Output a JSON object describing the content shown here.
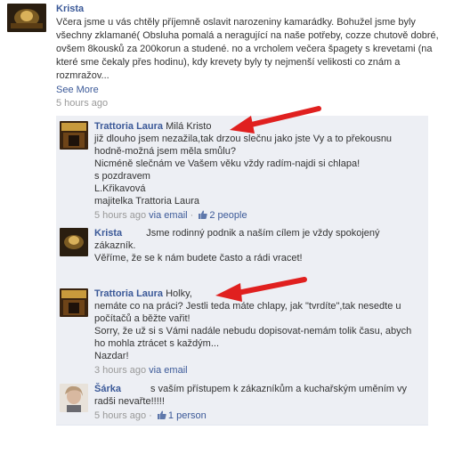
{
  "post": {
    "author": "Krista",
    "text": "Včera jsme u vás chtěly příjemně oslavit narozeniny kamarádky. Bohužel jsme byly všechny zklamané( Obsluha pomalá a neragující na naše potřeby, cozze chutově dobré, ovšem 8kousků za 200korun a studené. no a vrcholem večera špagety s krevetami (na které sme čekaly přes hodinu), kdy krevety byly ty nejmenší velikosti co znám a rozmražov...",
    "see_more": "See More",
    "time": "5 hours ago"
  },
  "comments": [
    {
      "author": "Trattoria Laura",
      "lines": [
        "Milá Kristo",
        "již dlouho jsem nezažila,tak drzou slečnu jako jste Vy a to překousnu hodně-možná jsem měla smůlu?",
        "Nicméně slečnám ve Vašem věku vždy radím-najdi si chlapa!",
        "s pozdravem",
        "L.Křikavová",
        "majitelka Trattoria Laura"
      ],
      "time": "5 hours ago",
      "via": "via email",
      "sep": "·",
      "likes": "2 people"
    },
    {
      "author": "Krista",
      "lines": [
        "Jsme rodinný podnik a naším cílem je vždy spokojený zákazník.",
        "Věříme, že se k nám budete často a rádi vracet!"
      ],
      "time": "",
      "via": "",
      "likes": ""
    },
    {
      "author": "Trattoria Laura",
      "lines": [
        "Holky,",
        "nemáte co na práci? Jestli teda máte chlapy, jak \"tvrdíte\",tak nesedte u počítačů a běžte vařit!",
        "Sorry, že už si s Vámi nadále nebudu dopisovat-nemám tolik času, abych ho mohla ztrácet s každým...",
        "Nazdar!"
      ],
      "time": "3 hours ago",
      "via": "via email",
      "likes": ""
    },
    {
      "author": "Šárka",
      "lines": [
        "s vaším přístupem k zákazníkům a kuchařským uměním vy radši nevařte!!!!!"
      ],
      "time": "5 hours ago",
      "via": "",
      "sep": "·",
      "likes": "1 person"
    }
  ],
  "colors": {
    "link": "#3b5998",
    "comment_bg": "#edeff4",
    "meta": "#999999",
    "arrow": "#e0201f"
  },
  "icons": {
    "like": "thumbs-up-icon"
  }
}
